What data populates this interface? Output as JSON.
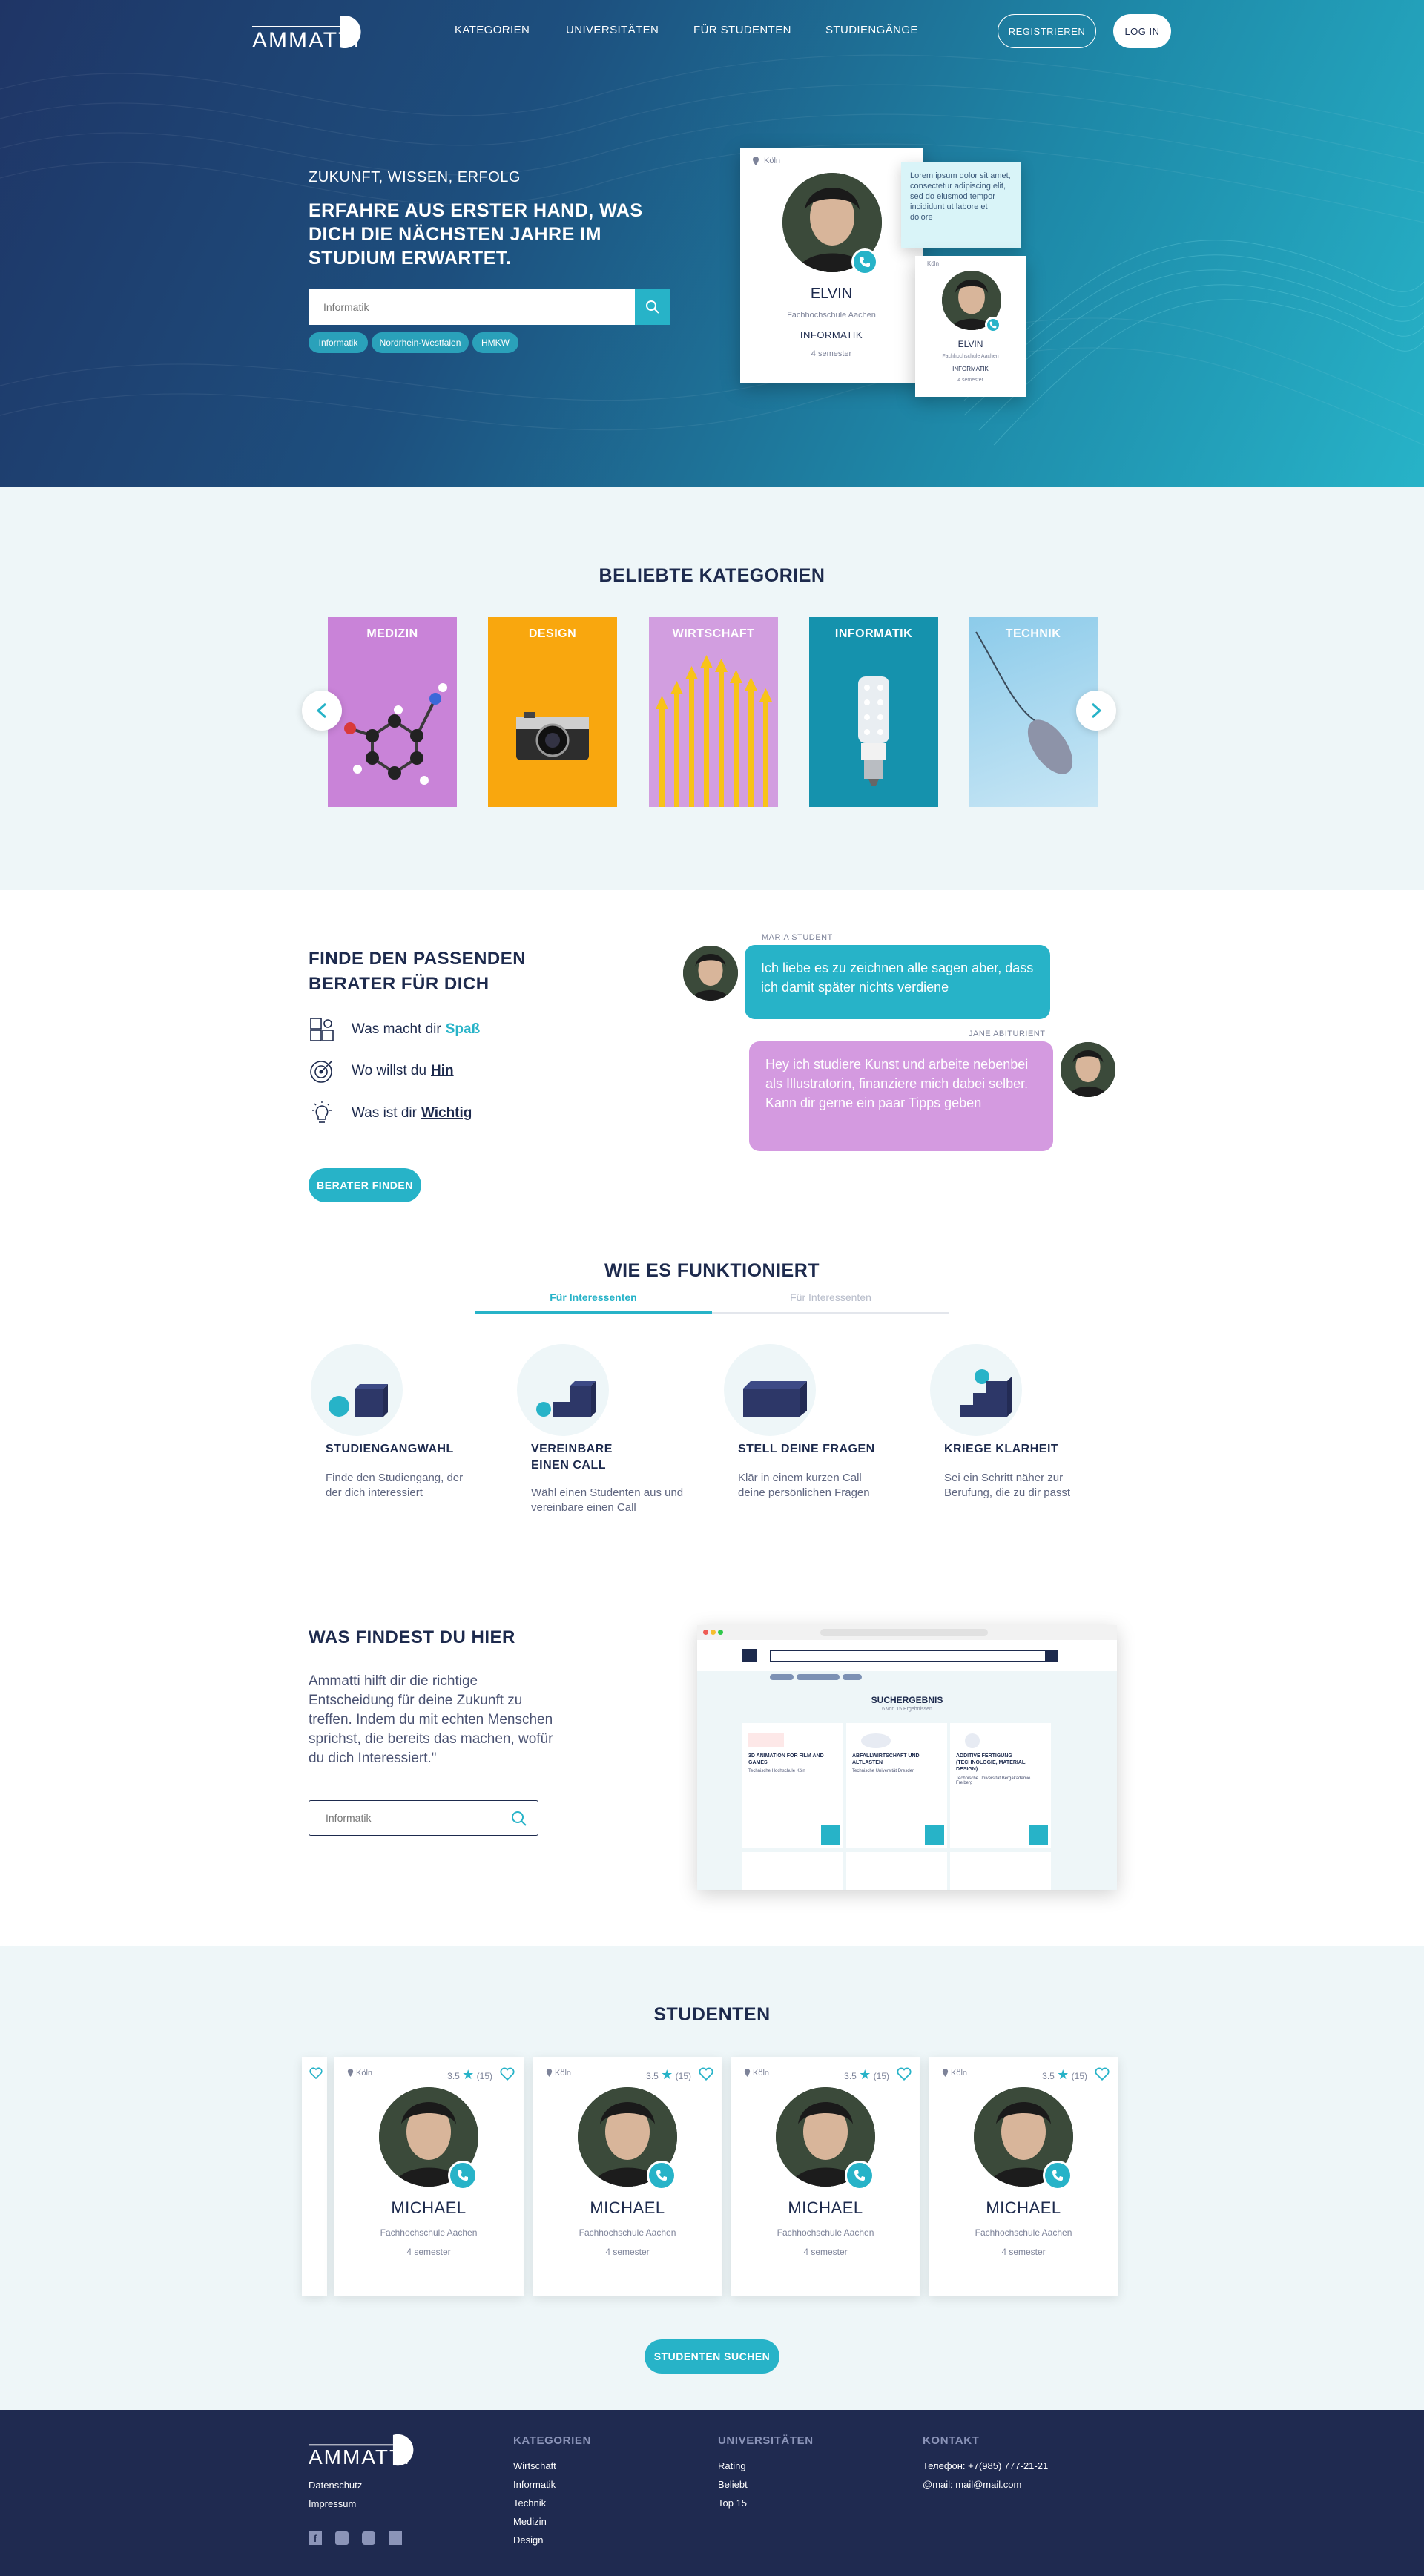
{
  "brand": {
    "logo_text": "AMMATTI"
  },
  "nav": {
    "items": [
      "KATEGORIEN",
      "UNIVERSITÄTEN",
      "FÜR STUDENTEN",
      "STUDIENGÄNGE"
    ],
    "register": "REGISTRIEREN",
    "login": "LOG IN"
  },
  "hero": {
    "kicker": "ZUKUNFT, WISSEN, ERFOLG",
    "title": "ERFAHRE AUS ERSTER HAND, WAS DICH DIE NÄCHSTEN JAHRE IM STUDIUM ERWARTET.",
    "search_placeholder": "Informatik",
    "tags": [
      "Informatik",
      "Nordrhein-Westfalen",
      "HMKW"
    ],
    "card_main": {
      "location": "Köln",
      "name": "ELVIN",
      "university": "Fachhochschule Aachen",
      "subject": "INFORMATIK",
      "semester": "4 semester"
    },
    "card_small": {
      "location": "Köln",
      "name": "ELVIN",
      "university": "Fachhochschule Aachen",
      "subject": "INFORMATIK",
      "semester": "4 semester"
    },
    "tooltip": "Lorem ipsum dolor sit amet, consectetur adipiscing elit, sed do eiusmod tempor incididunt ut labore et dolore"
  },
  "categories": {
    "title": "BELIEBTE KATEGORIEN",
    "items": [
      {
        "label": "MEDIZIN",
        "color": "#c983d8"
      },
      {
        "label": "DESIGN",
        "color": "#f9a70e"
      },
      {
        "label": "WIRTSCHAFT",
        "color": "#d29ee0"
      },
      {
        "label": "INFORMATIK",
        "color": "#1592ad"
      },
      {
        "label": "TECHNIK",
        "color": "#a9d6ee"
      }
    ]
  },
  "berater": {
    "title": "FINDE DEN PASSENDEN BERATER FÜR DICH",
    "features": [
      {
        "text": "Was macht dir",
        "highlight": "Spaß"
      },
      {
        "text": "Wo willst du",
        "highlight": "Hin"
      },
      {
        "text": "Was ist dir",
        "highlight": "Wichtig"
      }
    ],
    "button": "BERATER FINDEN",
    "chat": [
      {
        "author": "MARIA STUDENT",
        "text": "Ich liebe es zu zeichnen alle sagen aber, dass ich damit später nichts verdiene"
      },
      {
        "author": "JANE ABITURIENT",
        "text": "Hey ich studiere Kunst und arbeite nebenbei als Illustratorin, finanziere mich dabei selber. Kann dir gerne ein paar Tipps geben"
      }
    ]
  },
  "how": {
    "title": "WIE ES FUNKTIONIERT",
    "tabs": [
      "Für Interessenten",
      "Für Interessenten"
    ],
    "steps": [
      {
        "title": "STUDIENGANGWAHL",
        "text": "Finde den Studiengang, der der dich interessiert"
      },
      {
        "title": "VEREINBARE EINEN CALL",
        "text": "Wähl einen Studenten aus und vereinbare einen Call"
      },
      {
        "title": "STELL DEINE FRAGEN",
        "text": "Klär in einem kurzen Call deine persönlichen Fragen"
      },
      {
        "title": "KRIEGE KLARHEIT",
        "text": "Sei ein Schritt näher zur Berufung, die zu dir passt"
      }
    ]
  },
  "findest": {
    "title": "WAS FINDEST DU HIER",
    "text": "Ammatti hilft dir die richtige Entscheidung für deine Zukunft zu treffen. Indem du mit echten Menschen sprichst, die bereits das machen, wofür du dich Interessiert.\"",
    "search_placeholder": "Informatik",
    "preview": {
      "heading": "SUCHERGEBNIS",
      "subheading": "6 von 15 Ergebnissen",
      "cards": [
        {
          "title": "3D ANIMATION FOR FILM AND GAMES",
          "uni": "Technische Hochschule Köln"
        },
        {
          "title": "ABFALLWIRTSCHAFT UND ALTLASTEN",
          "uni": "Technische Universität Dresden"
        },
        {
          "title": "ADDITIVE FERTIGUNG (TECHNOLOGIE, MATERIAL, DESIGN)",
          "uni": "Technische Universität Bergakademie Freiberg"
        }
      ]
    }
  },
  "students": {
    "title": "STUDENTEN",
    "button": "STUDENTEN SUCHEN",
    "cards": [
      {
        "location": "Köln",
        "rating": "3.5",
        "reviews": "(15)",
        "name": "MICHAEL",
        "university": "Fachhochschule Aachen",
        "semester": "4 semester"
      },
      {
        "location": "Köln",
        "rating": "3.5",
        "reviews": "(15)",
        "name": "MICHAEL",
        "university": "Fachhochschule Aachen",
        "semester": "4 semester"
      },
      {
        "location": "Köln",
        "rating": "3.5",
        "reviews": "(15)",
        "name": "MICHAEL",
        "university": "Fachhochschule Aachen",
        "semester": "4 semester"
      },
      {
        "location": "Köln",
        "rating": "3.5",
        "reviews": "(15)",
        "name": "MICHAEL",
        "university": "Fachhochschule Aachen",
        "semester": "4 semester"
      }
    ]
  },
  "footer": {
    "links_left": [
      "Datenschutz",
      "Impressum"
    ],
    "kategorien": {
      "title": "KATEGORIEN",
      "items": [
        "Wirtschaft",
        "Informatik",
        "Technik",
        "Medizin",
        "Design"
      ]
    },
    "universitaeten": {
      "title": "UNIVERSITÄTEN",
      "items": [
        "Rating",
        "Beliebt",
        "Top 15"
      ]
    },
    "kontakt": {
      "title": "KONTAKT",
      "phone": "Телефон: +7(985) 777-21-21",
      "email": "@mail:  mail@mail.com"
    }
  }
}
